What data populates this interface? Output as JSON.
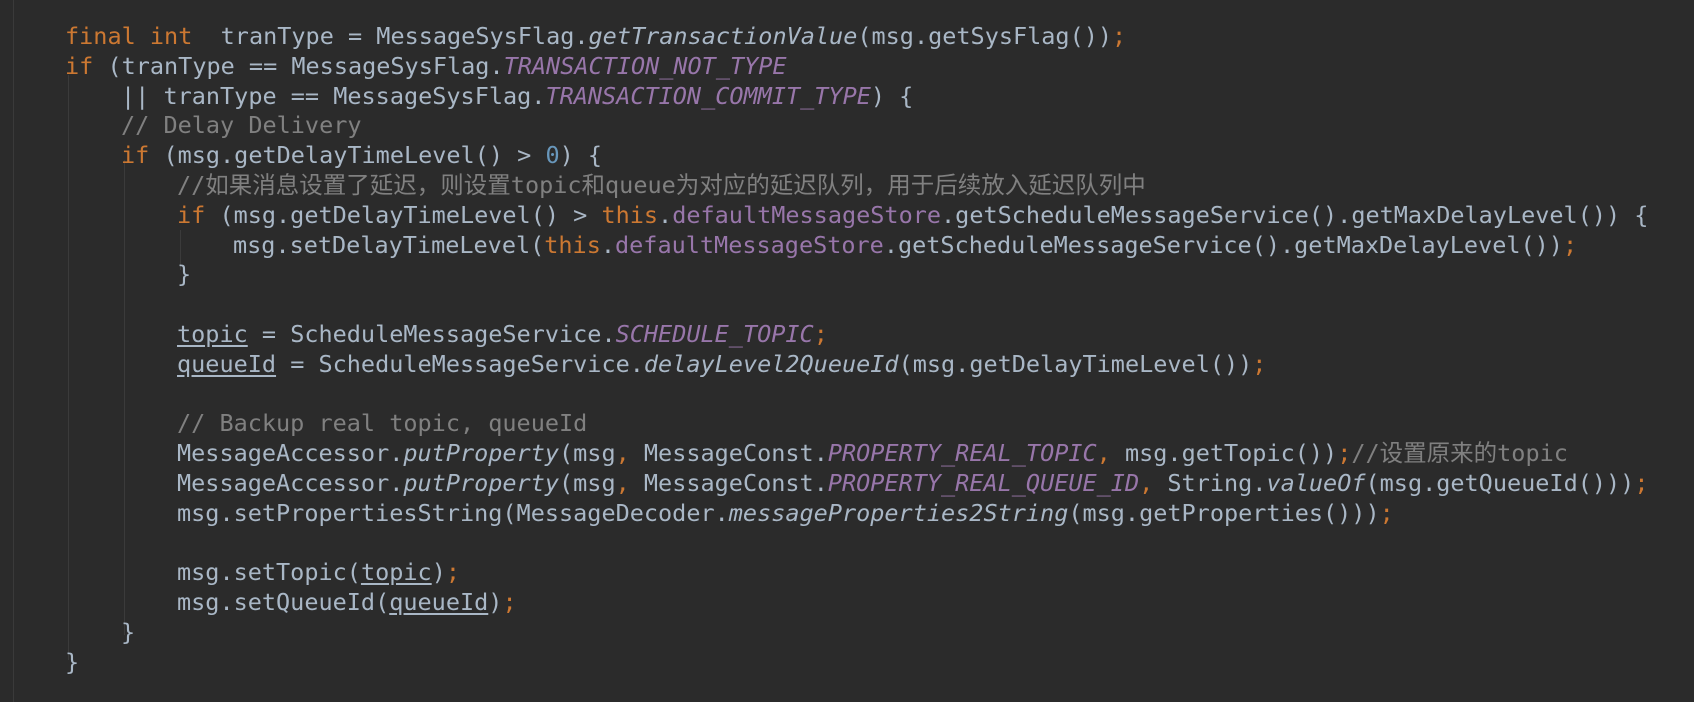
{
  "editor": {
    "background": "#2b2b2b",
    "colors": {
      "text": "#a9b7c6",
      "keyword": "#cc7832",
      "field": "#9876aa",
      "number": "#6897bb",
      "comment": "#808080"
    },
    "lines": [
      {
        "kind": "l1",
        "t": [
          "final",
          "int",
          " tranType = MessageSysFlag.",
          "getTransactionValue",
          "(msg.getSysFlag())",
          ";"
        ]
      },
      {
        "kind": "l2",
        "t": [
          "if",
          " (tranType == MessageSysFlag.",
          "TRANSACTION_NOT_TYPE"
        ]
      },
      {
        "kind": "l3",
        "t": [
          "|| tranType == MessageSysFlag.",
          "TRANSACTION_COMMIT_TYPE",
          ") {"
        ]
      },
      {
        "kind": "comment",
        "indent": 1,
        "t": [
          "// Delay Delivery"
        ]
      },
      {
        "kind": "l5",
        "t": [
          "if",
          " (msg.getDelayTimeLevel() > ",
          "0",
          ") {"
        ]
      },
      {
        "kind": "comment",
        "indent": 2,
        "t": [
          "//如果消息设置了延迟，则设置topic和queue为对应的延迟队列，用于后续放入延迟队列中"
        ]
      },
      {
        "kind": "l7",
        "t": [
          "if",
          " (msg.getDelayTimeLevel() > ",
          "this",
          ".",
          "defaultMessageStore",
          ".getScheduleMessageService().getMaxDelayLevel()) {"
        ]
      },
      {
        "kind": "l8",
        "t": [
          "msg.setDelayTimeLevel(",
          "this",
          ".",
          "defaultMessageStore",
          ".getScheduleMessageService().getMaxDelayLevel())",
          ";"
        ]
      },
      {
        "kind": "brace",
        "indent": 2,
        "t": [
          "}"
        ]
      },
      {
        "kind": "blank"
      },
      {
        "kind": "l11",
        "t": [
          "topic",
          " = ScheduleMessageService.",
          "SCHEDULE_TOPIC",
          ";"
        ]
      },
      {
        "kind": "l12",
        "t": [
          "queueId",
          " = ScheduleMessageService.",
          "delayLevel2QueueId",
          "(msg.getDelayTimeLevel())",
          ";"
        ]
      },
      {
        "kind": "blank"
      },
      {
        "kind": "comment",
        "indent": 2,
        "t": [
          "// Backup real topic, queueId"
        ]
      },
      {
        "kind": "l15",
        "t": [
          "MessageAccessor.",
          "putProperty",
          "(msg",
          ",",
          " MessageConst.",
          "PROPERTY_REAL_TOPIC",
          ",",
          " msg.getTopic())",
          ";",
          "//设置原来的topic"
        ]
      },
      {
        "kind": "l16",
        "t": [
          "MessageAccessor.",
          "putProperty",
          "(msg",
          ",",
          " MessageConst.",
          "PROPERTY_REAL_QUEUE_ID",
          ",",
          " String.",
          "valueOf",
          "(msg.getQueueId()))",
          ";"
        ]
      },
      {
        "kind": "l17",
        "t": [
          "msg.setPropertiesString(MessageDecoder.",
          "messageProperties2String",
          "(msg.getProperties()))",
          ";"
        ]
      },
      {
        "kind": "blank"
      },
      {
        "kind": "l19",
        "t": [
          "msg.setTopic(",
          "topic",
          ")",
          ";"
        ]
      },
      {
        "kind": "l20",
        "t": [
          "msg.setQueueId(",
          "queueId",
          ")",
          ";"
        ]
      },
      {
        "kind": "brace",
        "indent": 1,
        "t": [
          "}"
        ]
      },
      {
        "kind": "brace",
        "indent": 0,
        "t": [
          "}"
        ]
      }
    ]
  }
}
